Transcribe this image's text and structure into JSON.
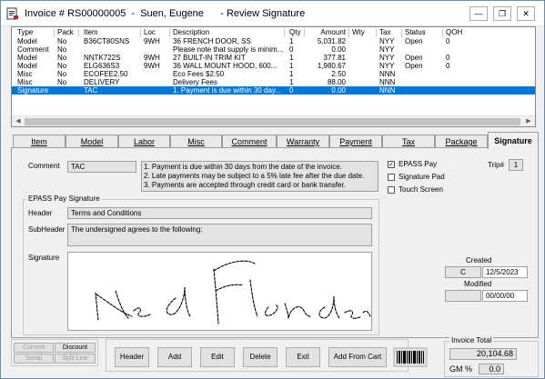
{
  "window": {
    "title": "Invoice # RS00000005  -  Suen, Eugene      - Review Signature"
  },
  "grid": {
    "headers": [
      "Type",
      "Pack",
      "Item",
      "Loc",
      "Description",
      "Qty",
      "Amount",
      "Wty",
      "Tax",
      "Status",
      "QOH"
    ],
    "rows": [
      [
        "Model",
        "No",
        "B36CT80SNS",
        "9WH",
        "36 FRENCH DOOR, SS",
        "1",
        "5,031.82",
        "",
        "NYY",
        "Open",
        "0"
      ],
      [
        "Comment",
        "No",
        "",
        "",
        "Please note that supply is minim...",
        "0",
        "0.00",
        "",
        "NYY",
        "",
        ""
      ],
      [
        "Model",
        "No",
        "NNTK722S",
        "9WH",
        "27 BUILT-IN TRIM KIT",
        "1",
        "377.81",
        "",
        "NYY",
        "Open",
        "0"
      ],
      [
        "Model",
        "No",
        "ELG636S3",
        "9WH",
        "36 WALL MOUNT HOOD, 600...",
        "1",
        "1,980.67",
        "",
        "NYY",
        "Open",
        "0"
      ],
      [
        "Misc",
        "No",
        "ECOFEE2.50",
        "",
        "Eco Fees $2.50",
        "1",
        "2.50",
        "",
        "NNN",
        "",
        ""
      ],
      [
        "Misc",
        "No",
        "DELIVERY",
        "",
        "Delivery Fees",
        "1",
        "88.00",
        "",
        "NNN",
        "",
        ""
      ],
      [
        "Signature",
        "",
        "TAC",
        "",
        "1. Payment is due within 30 day...",
        "0",
        "0.00",
        "",
        "NNN",
        "",
        ""
      ]
    ]
  },
  "tabs": [
    "Item",
    "Model",
    "Labor",
    "Misc",
    "Comment",
    "Warranty",
    "Payment",
    "Tax",
    "Package",
    "Signature"
  ],
  "signature_tab": {
    "comment_label": "Comment",
    "comment_code": "TAC",
    "comment_lines": [
      "1. Payment is due within 30 days from the date of the invoice.",
      "2. Late payments may be subject to a 5% late fee after the due date.",
      "3. Payments are accepted through credit card or bank transfer."
    ],
    "epass_pay_label": "EPASS Pay",
    "epass_pay_checked": true,
    "signature_pad_label": "Signature Pad",
    "signature_pad_checked": false,
    "touch_screen_label": "Touch Screen",
    "touch_screen_checked": false,
    "trip_label": "Trip#",
    "trip_value": "1",
    "group_title": "EPASS Pay Signature",
    "header_label": "Header",
    "header_value": "Terms and Conditions",
    "subheader_label": "SubHeader",
    "subheader_value": "The undersigned agrees to the following:",
    "signature_label": "Signature",
    "created_label": "Created",
    "created_code": "C",
    "created_date": "12/5/2023",
    "modified_label": "Modified",
    "modified_code": "",
    "modified_date": "00/00/00"
  },
  "bottom": {
    "commit": "Commit",
    "discount": "Discount",
    "serial": "Serial",
    "split_line": "Split Line",
    "header": "Header",
    "add": "Add",
    "edit": "Edit",
    "delete": "Delete",
    "exit": "Exit",
    "add_from_cart": "Add From Cart",
    "invoice_total_label": "Invoice Total",
    "invoice_total": "20,104.68",
    "gm_label": "GM %",
    "gm_value": "0.0"
  }
}
